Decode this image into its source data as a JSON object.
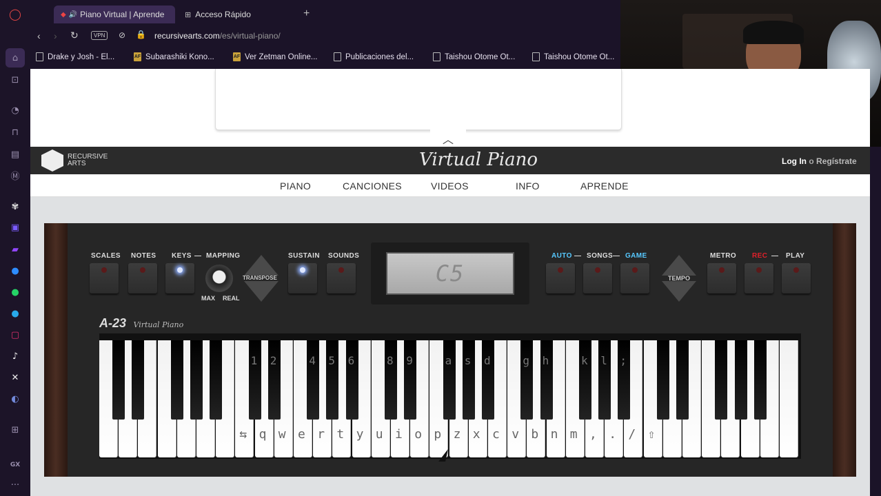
{
  "browser": {
    "tabs": [
      {
        "label": "Piano Virtual | Aprende"
      },
      {
        "label": "Acceso Rápido"
      }
    ],
    "new_tab": "+",
    "address": {
      "host": "recursivearts.com",
      "path": "/es/virtual-piano/"
    },
    "vpn": "VPN",
    "bookmarks": [
      {
        "label": "Drake y Josh - El...",
        "icon": "page-icon"
      },
      {
        "label": "Subarashiki Kono...",
        "icon": "af-icon"
      },
      {
        "label": "Ver Zetman Online...",
        "icon": "af-icon"
      },
      {
        "label": "Publicaciones del...",
        "icon": "page-icon"
      },
      {
        "label": "Taishou Otome Ot...",
        "icon": "page-icon"
      },
      {
        "label": "Taishou Otome Ot...",
        "icon": "page-icon"
      }
    ],
    "sidebar_icons": [
      "home-icon",
      "gamepad-icon",
      "clock-icon",
      "bag-icon",
      "chart-icon",
      "m-icon",
      "openai-icon",
      "css-icon",
      "twitch-icon",
      "messenger-icon",
      "whatsapp-icon",
      "telegram-icon",
      "instagram-icon",
      "tiktok-icon",
      "x-icon",
      "discord-icon",
      "grid-icon",
      "gx-icon",
      "more-icon"
    ],
    "sidebar_gx": "GX"
  },
  "site": {
    "brand_line1": "RECURSIVE",
    "brand_line2": "ARTS",
    "logo_text": "Virtual Piano",
    "login": "Log In",
    "or": "o",
    "register": "Regístrate",
    "nav": [
      "PIANO",
      "CANCIONES",
      "VIDEOS",
      "INFO",
      "APRENDE"
    ]
  },
  "piano": {
    "labels": {
      "scales": "SCALES",
      "notes": "NOTES",
      "keys": "KEYS",
      "mapping": "MAPPING",
      "transpose": "TRANSPOSE",
      "max": "MAX",
      "real": "REAL",
      "sustain": "SUSTAIN",
      "sounds": "SOUNDS",
      "auto": "AUTO",
      "songs": "SONGS",
      "game": "GAME",
      "tempo": "TEMPO",
      "metro": "METRO",
      "rec": "REC",
      "play": "PLAY",
      "dash": "—"
    },
    "display": "C5",
    "model": "A-23",
    "model_sub": "Virtual Piano",
    "white_key_labels": [
      "⇆",
      "q",
      "w",
      "e",
      "r",
      "t",
      "y",
      "u",
      "i",
      "o",
      "p",
      "z",
      "x",
      "c",
      "v",
      "b",
      "n",
      "m",
      ",",
      ".",
      "/",
      "⇧"
    ],
    "black_key_labels": [
      "1",
      "2",
      "4",
      "5",
      "6",
      "8",
      "9",
      "a",
      "s",
      "d",
      "g",
      "h",
      "k",
      "l",
      ";"
    ],
    "accent": "#57c9ff",
    "rec_color": "#e0202a"
  }
}
